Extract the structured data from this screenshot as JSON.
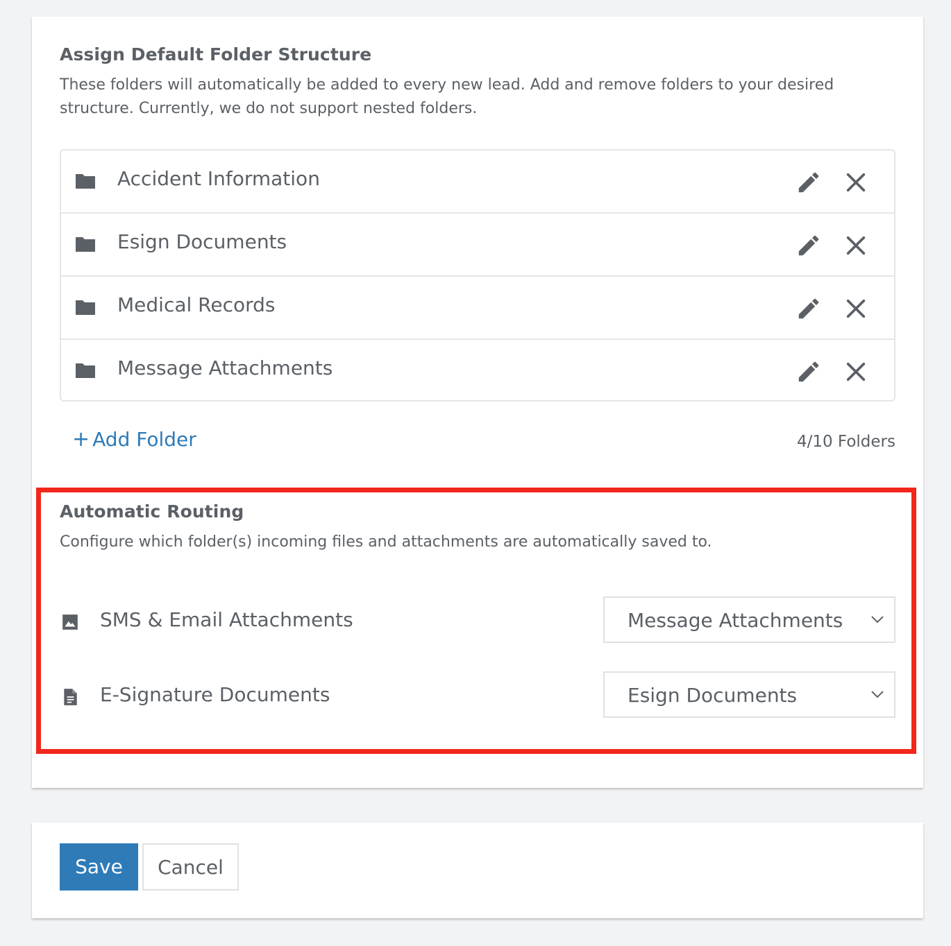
{
  "folder_structure": {
    "title": "Assign Default Folder Structure",
    "description": "These folders will automatically be added to every new lead. Add and remove folders to your desired structure. Currently, we do not support nested folders.",
    "folders": [
      {
        "name": "Accident Information",
        "icon": "folder-icon"
      },
      {
        "name": "Esign Documents",
        "icon": "folder-icon"
      },
      {
        "name": "Medical Records",
        "icon": "folder-icon"
      },
      {
        "name": "Message Attachments",
        "icon": "folder-icon"
      }
    ],
    "add_folder_plus": "+",
    "add_folder_label": "Add Folder",
    "folder_count": "4/10 Folders"
  },
  "routing": {
    "title": "Automatic Routing",
    "description": "Configure which folder(s) incoming files and attachments are automatically saved to.",
    "rules": [
      {
        "label": "SMS & Email Attachments",
        "icon": "image-icon",
        "selected": "Message Attachments"
      },
      {
        "label": "E-Signature Documents",
        "icon": "document-icon",
        "selected": "Esign Documents"
      }
    ]
  },
  "actions": {
    "save_label": "Save",
    "cancel_label": "Cancel"
  },
  "colors": {
    "accent": "#2e7bb8",
    "highlight": "#f2271b",
    "text": "#5b6066",
    "background": "#f2f3f5"
  }
}
